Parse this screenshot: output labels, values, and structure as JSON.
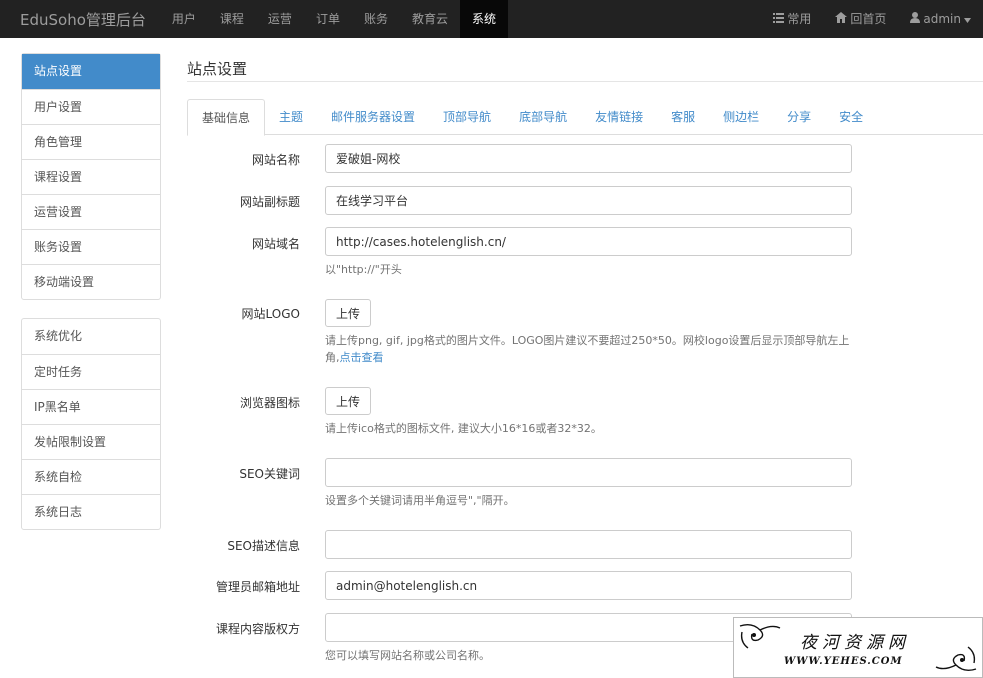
{
  "brand": "EduSoho管理后台",
  "nav": {
    "items": [
      "用户",
      "课程",
      "运营",
      "订单",
      "账务",
      "教育云",
      "系统"
    ],
    "active": "系统",
    "right": {
      "common_label": "常用",
      "home_label": "回首页",
      "user_label": "admin"
    }
  },
  "sidebar": {
    "group1": [
      "站点设置",
      "用户设置",
      "角色管理",
      "课程设置",
      "运营设置",
      "账务设置",
      "移动端设置"
    ],
    "group2": [
      "系统优化",
      "定时任务",
      "IP黑名单",
      "发帖限制设置",
      "系统自检",
      "系统日志"
    ],
    "active": "站点设置"
  },
  "page": {
    "title": "站点设置"
  },
  "tabs": [
    "基础信息",
    "主题",
    "邮件服务器设置",
    "顶部导航",
    "底部导航",
    "友情链接",
    "客服",
    "侧边栏",
    "分享",
    "安全"
  ],
  "form": {
    "site_name": {
      "label": "网站名称",
      "value": "爱破姐-网校"
    },
    "site_subtitle": {
      "label": "网站副标题",
      "value": "在线学习平台"
    },
    "site_domain": {
      "label": "网站域名",
      "value": "http://cases.hotelenglish.cn/",
      "help": "以\"http://\"开头"
    },
    "site_logo": {
      "label": "网站LOGO",
      "button": "上传",
      "help": "请上传png, gif, jpg格式的图片文件。LOGO图片建议不要超过250*50。网校logo设置后显示顶部导航左上角,",
      "help_link": "点击查看"
    },
    "favicon": {
      "label": "浏览器图标",
      "button": "上传",
      "help": "请上传ico格式的图标文件, 建议大小16*16或者32*32。"
    },
    "seo_keywords": {
      "label": "SEO关键词",
      "value": "",
      "help": "设置多个关键词请用半角逗号\",\"隔开。"
    },
    "seo_description": {
      "label": "SEO描述信息",
      "value": ""
    },
    "admin_email": {
      "label": "管理员邮箱地址",
      "value": "admin@hotelenglish.cn"
    },
    "copyright": {
      "label": "课程内容版权方",
      "value": "",
      "help": "您可以填写网站名称或公司名称。"
    }
  },
  "watermark": {
    "title": "夜河资源网",
    "url": "WWW.YEHES.COM"
  }
}
